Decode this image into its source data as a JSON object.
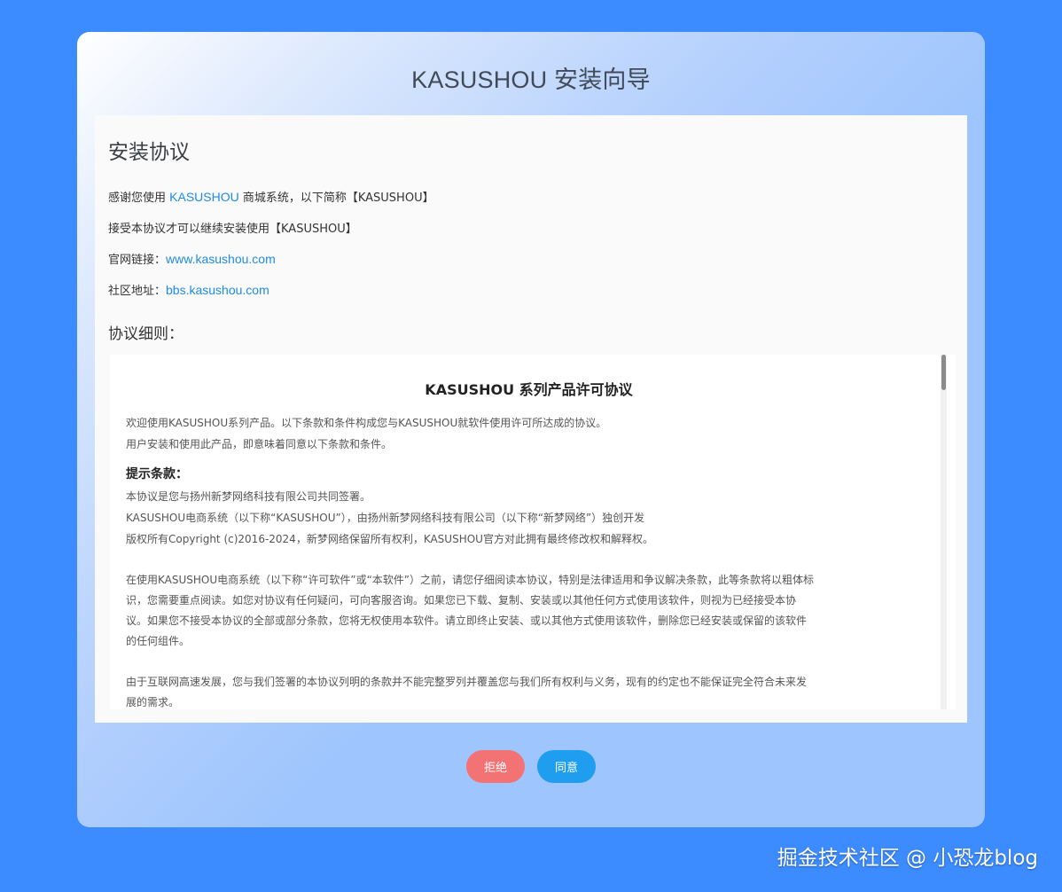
{
  "wizard": {
    "title": "KASUSHOU 安装向导"
  },
  "panel": {
    "title": "安装协议",
    "intro_prefix": "感谢您使用 ",
    "intro_link": "KASUSHOU",
    "intro_suffix": " 商城系统，以下简称【KASUSHOU】",
    "accept_line": "接受本协议才可以继续安装使用【KASUSHOU】",
    "website_label": "官网链接：",
    "website_link": "www.kasushou.com",
    "community_label": "社区地址：",
    "community_link": "bbs.kasushou.com",
    "details_title": "协议细则："
  },
  "agreement": {
    "title": "KASUSHOU 系列产品许可协议",
    "welcome_line1": "欢迎使用KASUSHOU系列产品。以下条款和条件构成您与KASUSHOU就软件使用许可所达成的协议。",
    "welcome_line2": "用户安装和使用此产品，即意味着同意以下条款和条件。",
    "notice_title": "提示条款：",
    "notice_line1": "本协议是您与扬州新梦网络科技有限公司共同签署。",
    "notice_line2": "KASUSHOU电商系统（以下称“KASUSHOU”），由扬州新梦网络科技有限公司（以下称“新梦网络”）独创开发",
    "notice_line3": "版权所有Copyright (c)2016-2024，新梦网络保留所有权利，KASUSHOU官方对此拥有最终修改权和解释权。",
    "para1_line1": "在使用KASUSHOU电商系统（以下称“许可软件”或“本软件”）之前，请您仔细阅读本协议，特别是法律适用和争议解决条款，此等条款将以粗体标",
    "para1_line2": "识，您需要重点阅读。如您对协议有任何疑问，可向客服咨询。如果您已下载、复制、安装或以其他任何方式使用该软件，则视为已经接受本协",
    "para1_line3": "议。如果您不接受本协议的全部或部分条款，您将无权使用本软件。请立即终止安装、或以其他方式使用该软件，删除您已经安装或保留的该软件",
    "para1_line4": "的任何组件。",
    "para2_line1": "由于互联网高速发展，您与我们签署的本协议列明的条款并不能完整罗列并覆盖您与我们所有权利与义务，现有的约定也不能保证完全符合未来发",
    "para2_line2": "展的需求。"
  },
  "buttons": {
    "reject": "拒绝",
    "agree": "同意"
  },
  "colors": {
    "background": "#3d8cff",
    "link": "#1e8ce6",
    "reject": "#f37274",
    "agree": "#1f9ef0"
  },
  "watermark": "掘金技术社区 @ 小恐龙blog"
}
